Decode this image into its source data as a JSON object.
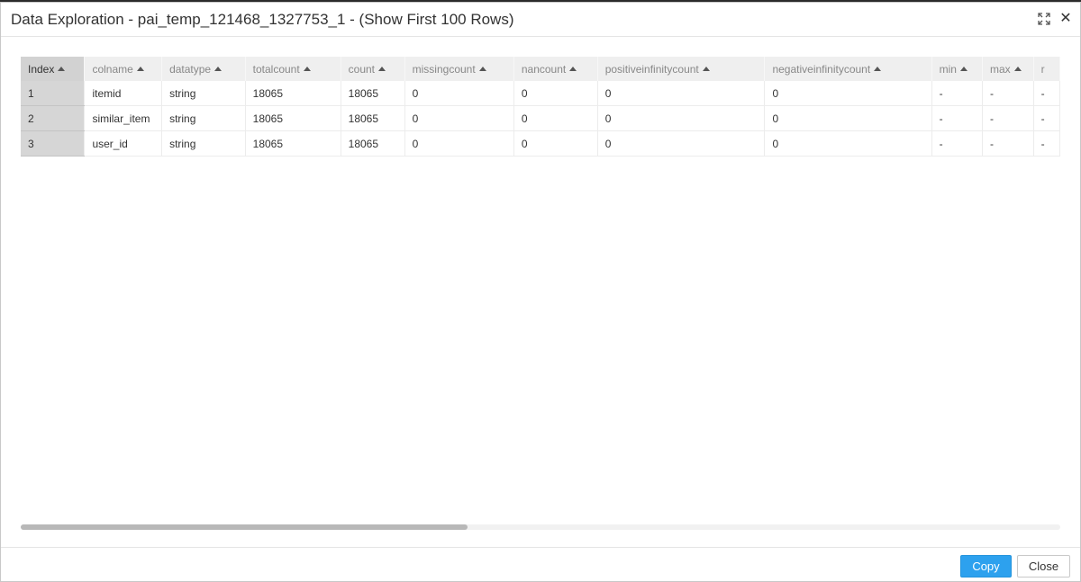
{
  "dialog": {
    "title": "Data Exploration - pai_temp_121468_1327753_1 - (Show First 100 Rows)"
  },
  "table": {
    "columns": [
      {
        "label": "Index"
      },
      {
        "label": "colname"
      },
      {
        "label": "datatype"
      },
      {
        "label": "totalcount"
      },
      {
        "label": "count"
      },
      {
        "label": "missingcount"
      },
      {
        "label": "nancount"
      },
      {
        "label": "positiveinfinitycount"
      },
      {
        "label": "negativeinfinitycount"
      },
      {
        "label": "min"
      },
      {
        "label": "max"
      },
      {
        "label": "r"
      }
    ],
    "rows": [
      [
        "1",
        "itemid",
        "string",
        "18065",
        "18065",
        "0",
        "0",
        "0",
        "0",
        "-",
        "-",
        "-"
      ],
      [
        "2",
        "similar_item",
        "string",
        "18065",
        "18065",
        "0",
        "0",
        "0",
        "0",
        "-",
        "-",
        "-"
      ],
      [
        "3",
        "user_id",
        "string",
        "18065",
        "18065",
        "0",
        "0",
        "0",
        "0",
        "-",
        "-",
        "-"
      ]
    ]
  },
  "scrollbar": {
    "visible_fraction": 0.43
  },
  "footer": {
    "copy_label": "Copy",
    "close_label": "Close"
  },
  "colors": {
    "accent": "#2da1ee"
  },
  "icons": {
    "maximize": "expand-icon",
    "close": "close-icon"
  }
}
